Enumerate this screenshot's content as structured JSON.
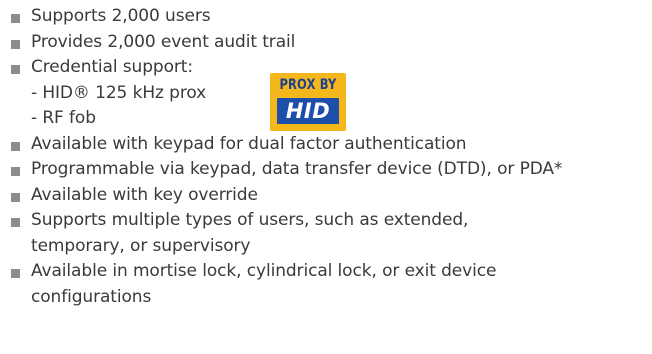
{
  "features": [
    {
      "lines": [
        "Supports 2,000 users"
      ]
    },
    {
      "lines": [
        "Provides 2,000 event audit trail"
      ]
    },
    {
      "lines": [
        "Credential support:"
      ],
      "sub": [
        "- HID® 125 kHz prox",
        "- RF fob"
      ]
    },
    {
      "lines": [
        "Available with keypad for dual factor authentication"
      ]
    },
    {
      "lines": [
        "Programmable via keypad, data transfer device (DTD), or PDA*"
      ]
    },
    {
      "lines": [
        "Available with key override"
      ]
    },
    {
      "lines": [
        "Supports multiple types of users, such as extended,",
        "temporary, or supervisory"
      ]
    },
    {
      "lines": [
        "Available in mortise lock, cylindrical lock, or exit device",
        "configurations"
      ]
    }
  ],
  "badge": {
    "top": "PROX BY",
    "brand": "HID"
  },
  "colors": {
    "text": "#3a3a3a",
    "bullet": "#8c8c8c",
    "badge_bg": "#f4b81c",
    "badge_brand_bg": "#1e4fa8"
  }
}
